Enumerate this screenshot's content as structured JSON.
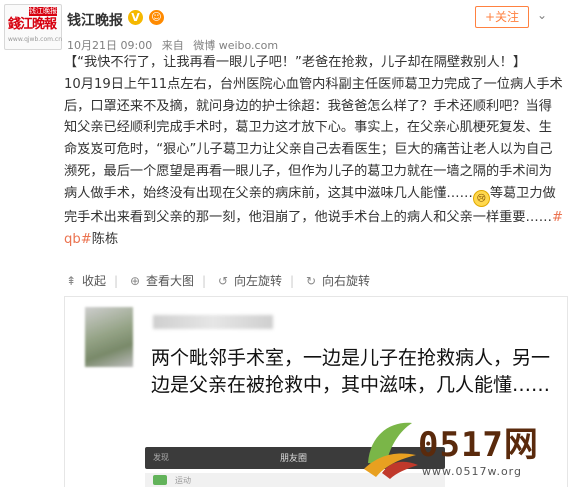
{
  "header": {
    "avatar": {
      "badge": "钱江晚报",
      "logo_text": "錢江晚報",
      "url": "www.qjwb.com.cn"
    },
    "author": "钱江晚报",
    "verify_icon": "V",
    "vip_icon": "vip-emoji",
    "date": "10月21日 09:00",
    "source_prefix": "来自",
    "source": "微博 weibo.com",
    "follow_label": "+关注",
    "more_icon": "chevron-down"
  },
  "post": {
    "headline": "【“我快不行了，让我再看一眼儿子吧！”老爸在抢救，儿子却在隔壁救别人！】",
    "body_before_emoji": "10月19日上午11点左右，台州医院心血管内科副主任医师葛卫力完成了一位病人手术后，口罩还来不及摘，就问身边的护士徐超：我爸爸怎么样了？手术还顺利吧？当得知父亲已经顺利完成手术时，葛卫力这才放下心。事实上，在父亲心肌梗死复发、生命岌岌可危时，“狠心”儿子葛卫力让父亲自己去看医生；巨大的痛苦让老人以为自己濒死，最后一个愿望是再看一眼儿子，但作为儿子的葛卫力就在一墙之隔的手术间为病人做手术，始终没有出现在父亲的病床前，这其中滋味几人能懂……",
    "body_after_emoji": "等葛卫力做完手术出来看到父亲的那一刻，他泪崩了，他说手术台上的病人和父亲一样重要……",
    "topic": "#qb#",
    "editor": "陈栋"
  },
  "actions": [
    {
      "label": "收起",
      "icon": "collapse-icon"
    },
    {
      "label": "查看大图",
      "icon": "zoom-icon"
    },
    {
      "label": "向左旋转",
      "icon": "rotate-left-icon"
    },
    {
      "label": "向右旋转",
      "icon": "rotate-right-icon"
    }
  ],
  "image": {
    "caption": "两个毗邻手术室，一边是儿子在抢救病人，另一边是父亲在被抢救中，其中滋味，几人能懂……",
    "phone_bar_left": "发现",
    "phone_bar_title": "朋友圈",
    "phone_row_text": "运动"
  },
  "watermark": {
    "title": "0517网",
    "url": "www.0517w.org"
  }
}
